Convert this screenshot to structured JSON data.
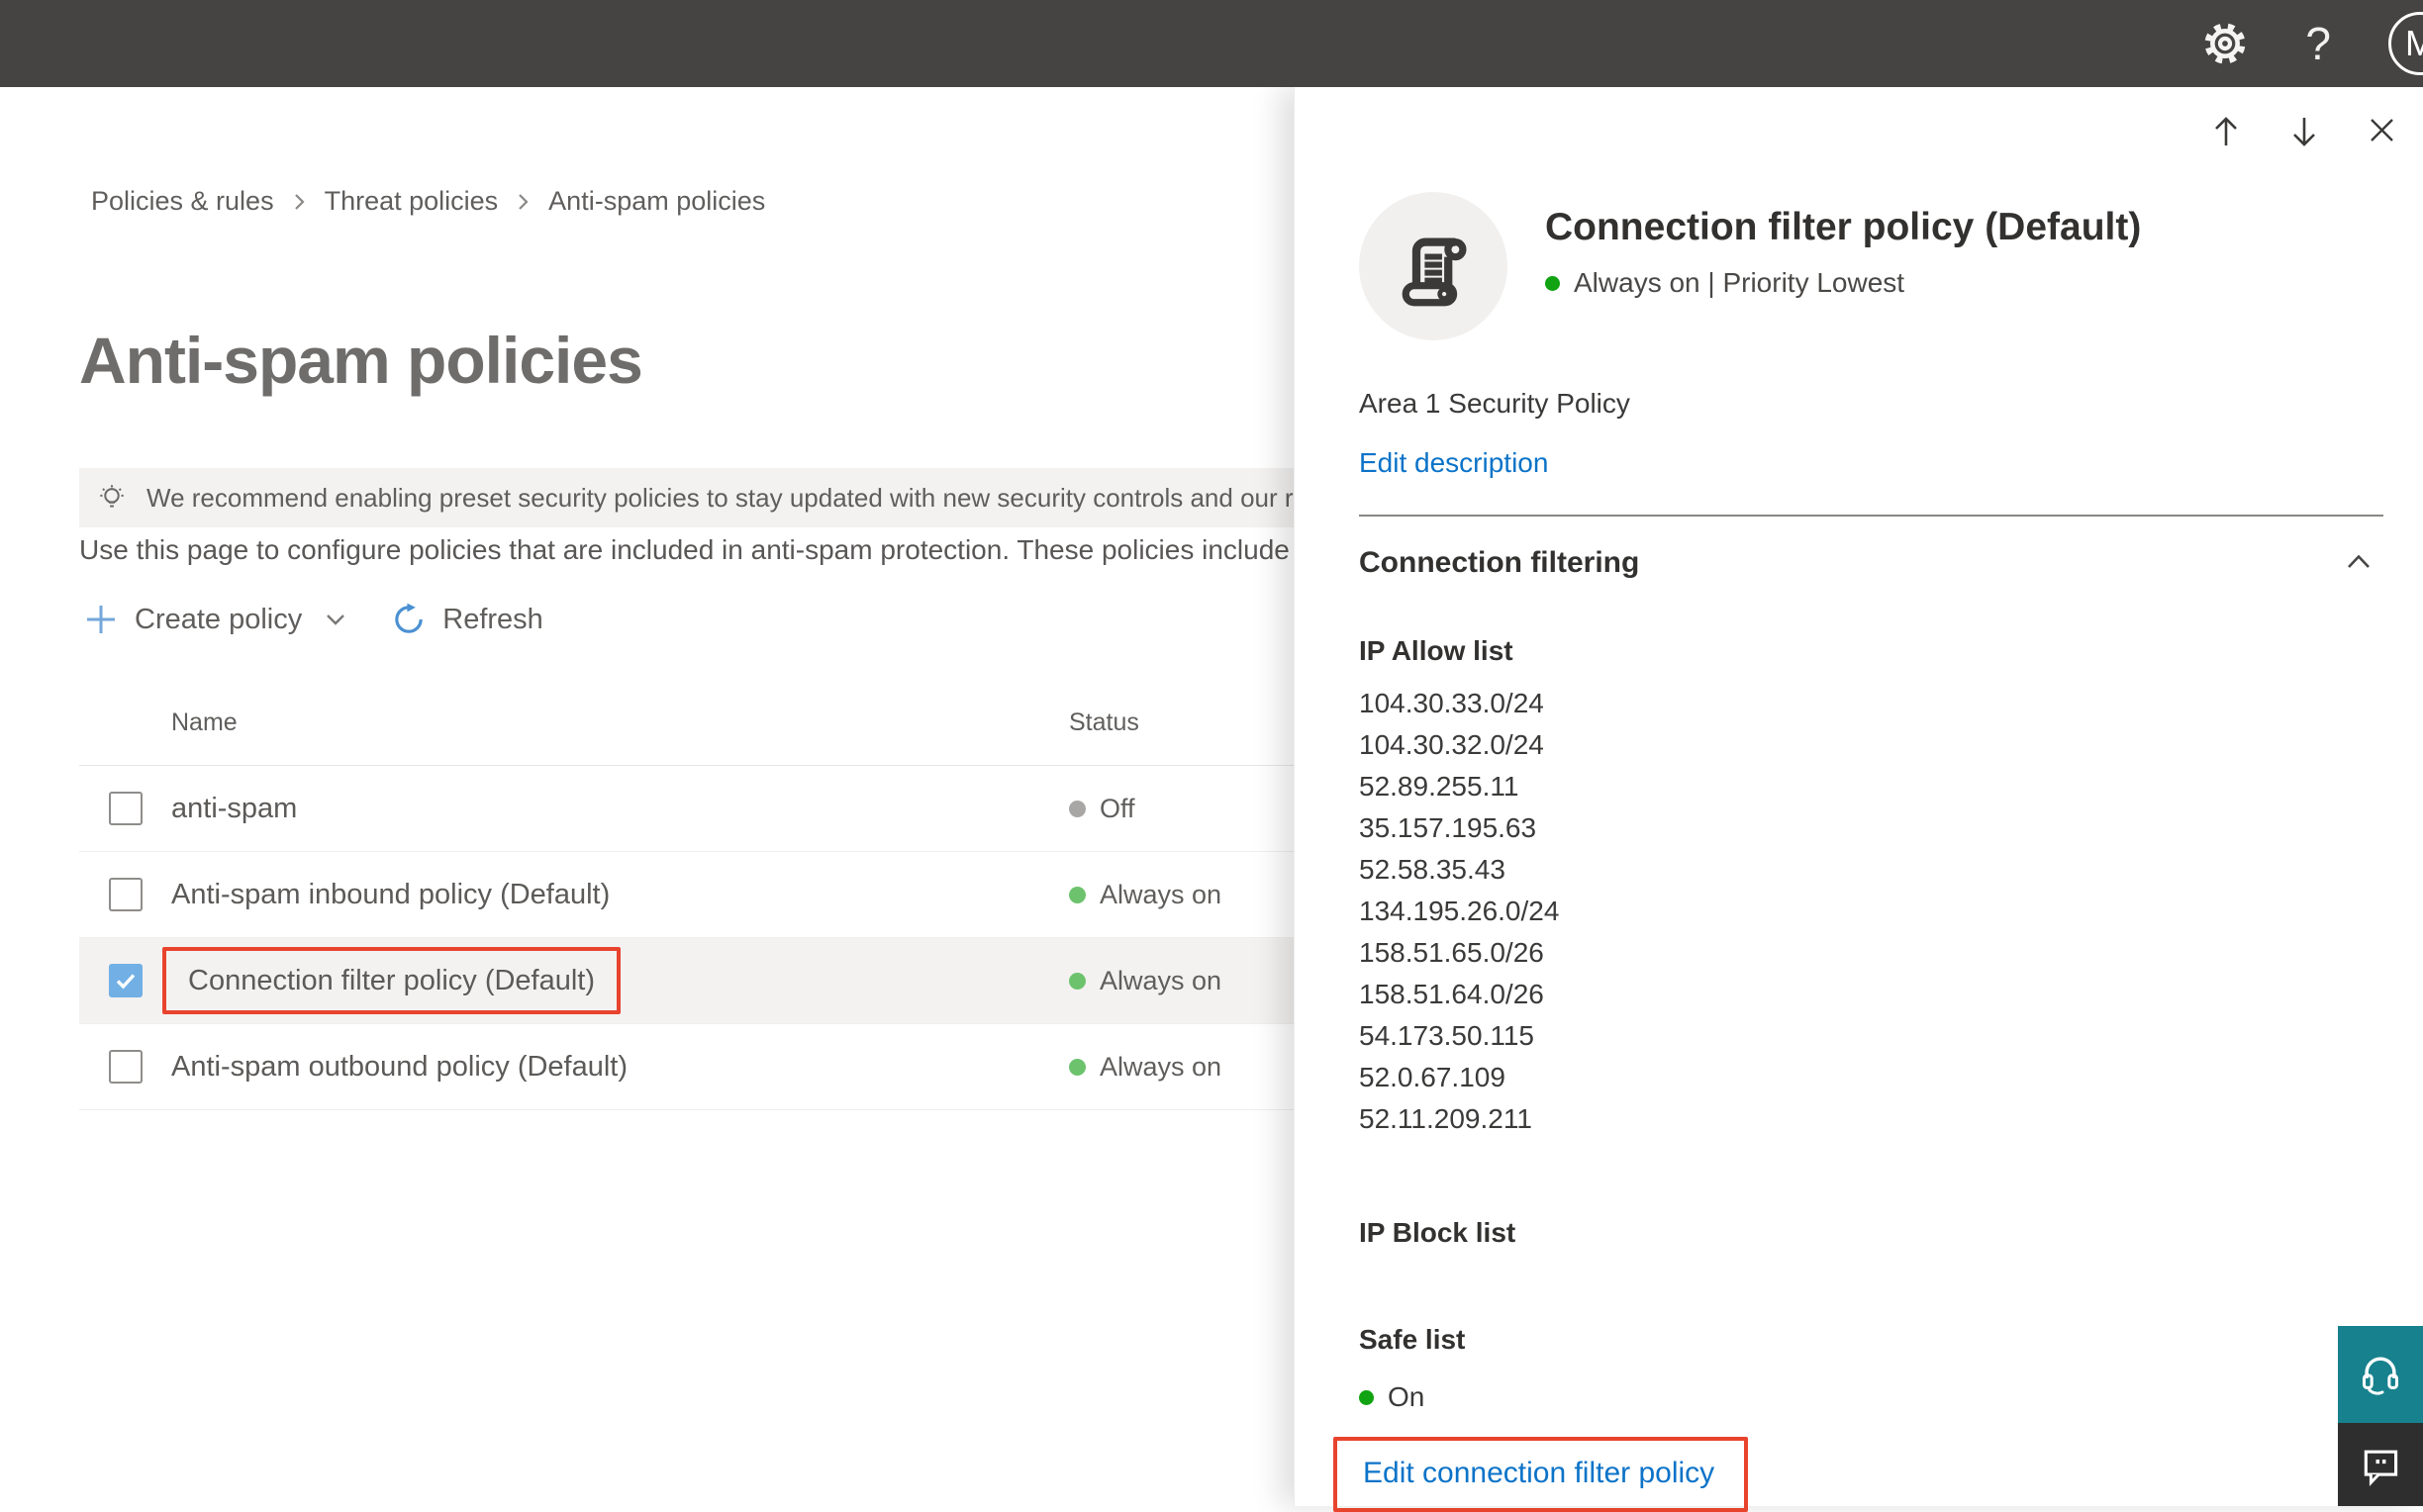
{
  "topbar": {
    "help_label": "?",
    "avatar_initial": "M"
  },
  "breadcrumb": {
    "items": [
      "Policies & rules",
      "Threat policies",
      "Anti-spam policies"
    ]
  },
  "page": {
    "title": "Anti-spam policies",
    "banner_text": "We recommend enabling preset security policies to stay updated with new security controls and our recomme",
    "intro_text": "Use this page to configure policies that are included in anti-spam protection. These policies include"
  },
  "toolbar": {
    "create_label": "Create policy",
    "refresh_label": "Refresh"
  },
  "table": {
    "columns": [
      "Name",
      "Status"
    ],
    "rows": [
      {
        "name": "anti-spam",
        "status": "Off"
      },
      {
        "name": "Anti-spam inbound policy (Default)",
        "status": "Always on"
      },
      {
        "name": "Connection filter policy (Default)",
        "status": "Always on"
      },
      {
        "name": "Anti-spam outbound policy (Default)",
        "status": "Always on"
      }
    ]
  },
  "panel": {
    "title": "Connection filter policy (Default)",
    "status_line": "Always on | Priority Lowest",
    "description": "Area 1 Security Policy",
    "edit_description_label": "Edit description",
    "section_title": "Connection filtering",
    "ip_allow_title": "IP Allow list",
    "ip_allow": [
      "104.30.33.0/24",
      "104.30.32.0/24",
      "52.89.255.11",
      "35.157.195.63",
      "52.58.35.43",
      "134.195.26.0/24",
      "158.51.65.0/26",
      "158.51.64.0/26",
      "54.173.50.115",
      "52.0.67.109",
      "52.11.209.211"
    ],
    "ip_block_title": "IP Block list",
    "safe_list_title": "Safe list",
    "safe_list_status": "On",
    "edit_link_label": "Edit connection filter policy"
  },
  "colors": {
    "topbar_bg": "#454442",
    "link_blue": "#0c73c8",
    "highlight_red": "#e8432d",
    "checkbox_blue": "#71afe5",
    "status_on_green": "#6dc36d",
    "status_off_gray": "#a9a7a5",
    "panel_status_green": "#11a311",
    "support_teal": "#17818d",
    "banner_bg": "#f3f2f1"
  }
}
